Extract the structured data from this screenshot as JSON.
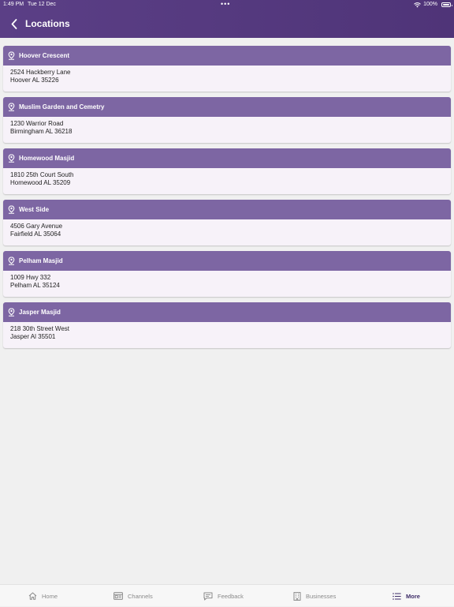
{
  "status": {
    "time": "1:49 PM",
    "date": "Tue 12 Dec",
    "battery": "100%"
  },
  "header": {
    "title": "Locations"
  },
  "locations": [
    {
      "name": "Hoover Crescent",
      "address1": "2524 Hackberry Lane",
      "address2": "Hoover AL 35226"
    },
    {
      "name": "Muslim Garden and Cemetry",
      "address1": "1230 Warrior Road",
      "address2": "Birmingham AL 36218"
    },
    {
      "name": "Homewood Masjid",
      "address1": "1810 25th Court South",
      "address2": "Homewood AL 35209"
    },
    {
      "name": "West Side",
      "address1": "4506 Gary Avenue",
      "address2": "Fairfield AL 35064"
    },
    {
      "name": "Pelham Masjid",
      "address1": "1009 Hwy 332",
      "address2": "Pelham AL 35124"
    },
    {
      "name": "Jasper Masjid",
      "address1": "218 30th Street West",
      "address2": "Jasper Al 35501"
    }
  ],
  "tabs": [
    {
      "label": "Home",
      "icon": "home-icon"
    },
    {
      "label": "Channels",
      "icon": "channels-icon"
    },
    {
      "label": "Feedback",
      "icon": "feedback-icon"
    },
    {
      "label": "Businesses",
      "icon": "businesses-icon"
    },
    {
      "label": "More",
      "icon": "more-icon",
      "active": true
    }
  ],
  "colors": {
    "header": "#533880",
    "card_header": "#7d66a3",
    "card_body": "#f7f2f9",
    "active_tab": "#3e2d68"
  }
}
